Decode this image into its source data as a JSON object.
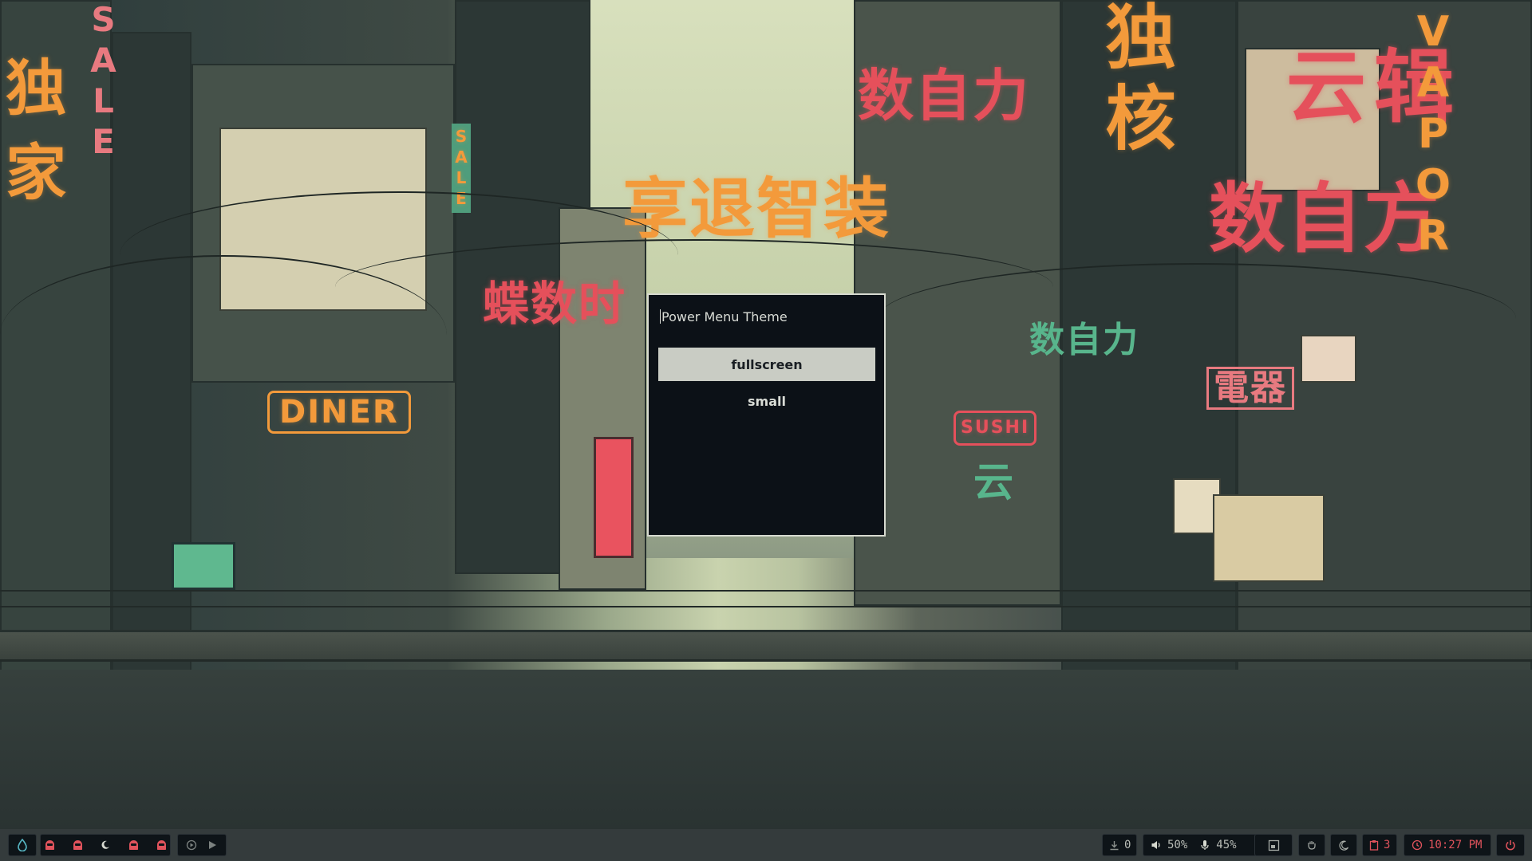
{
  "wallpaper": {
    "signs": {
      "top_center_right": "数自力",
      "center_large": "享退智装",
      "center_left_red": "蝶数时",
      "right_column": "独核",
      "right_red_large": "数自方",
      "right_red_top": "云",
      "right_red_second": "辑",
      "vertical_vapor": "VAPOR",
      "vertical_sale_left": "SALE",
      "vertical_sale_mid": "SALE",
      "left_column_chars": "独家",
      "diner": "DINER",
      "sushi": "SUSHI",
      "green_mid": "数自力",
      "appliance": "電器",
      "green_small": "云"
    }
  },
  "menu": {
    "placeholder": "Power Menu Theme",
    "items": [
      {
        "label": "fullscreen",
        "selected": true
      },
      {
        "label": "small",
        "selected": false
      }
    ]
  },
  "taskbar": {
    "launcher_icon": "droplet-icon",
    "workspaces_icons": [
      "ghost-icon",
      "ghost-icon",
      "moon-icon",
      "ghost-icon",
      "ghost-icon"
    ],
    "media": {
      "prev_icon": "play-circle-icon",
      "play_icon": "play-icon"
    },
    "downloads": {
      "icon": "download-icon",
      "count": "0"
    },
    "volume": {
      "icon": "speaker-icon",
      "value": "50%"
    },
    "microphone": {
      "icon": "microphone-icon",
      "value": "45%"
    },
    "icons": [
      "window-layout-icon",
      "hand-icon",
      "moon-icon"
    ],
    "clipboard": {
      "icon": "clipboard-icon",
      "count": "3"
    },
    "clock": {
      "icon": "clock-icon",
      "time": "10:27 PM"
    },
    "power_icon": "power-icon",
    "colors": {
      "accent_red": "#e0535c",
      "accent_teal": "#57b7c4",
      "bar_bg": "#0e1418"
    }
  }
}
